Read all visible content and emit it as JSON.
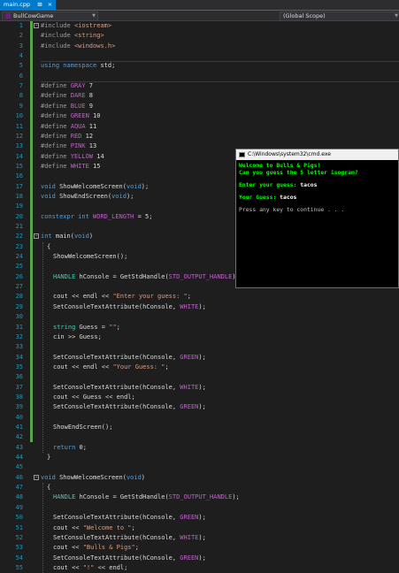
{
  "tab": {
    "label": "main.cpp",
    "pin": "⊞",
    "close": "×"
  },
  "nav": {
    "project": "BullCowGame",
    "scope": "(Global Scope)"
  },
  "console": {
    "title": "C:\\Windows\\system32\\cmd.exe",
    "lines": [
      "Welcome to Bulls & Pigs!",
      "Can you guess the 5 letter isogram?",
      "Enter your guess: ",
      "tacos",
      "Your Guess: ",
      "tacos",
      "Press any key to continue . . ."
    ]
  },
  "code": [
    {
      "n": "1",
      "t": "#include <iostream>"
    },
    {
      "n": "2",
      "t": "#include <string>"
    },
    {
      "n": "3",
      "t": "#include <windows.h>"
    },
    {
      "n": "4",
      "t": ""
    },
    {
      "n": "5",
      "t": "using namespace std;"
    },
    {
      "n": "6",
      "t": ""
    },
    {
      "n": "7",
      "t": "#define GRAY 7"
    },
    {
      "n": "8",
      "t": "#define DARE 8"
    },
    {
      "n": "9",
      "t": "#define BLUE 9"
    },
    {
      "n": "10",
      "t": "#define GREEN 10"
    },
    {
      "n": "11",
      "t": "#define AQUA 11"
    },
    {
      "n": "12",
      "t": "#define RED 12"
    },
    {
      "n": "13",
      "t": "#define PINK 13"
    },
    {
      "n": "14",
      "t": "#define YELLOW 14"
    },
    {
      "n": "15",
      "t": "#define WHITE 15"
    },
    {
      "n": "16",
      "t": ""
    },
    {
      "n": "17",
      "t": "void ShowWelcomeScreen(void);"
    },
    {
      "n": "18",
      "t": "void ShowEndScreen(void);"
    },
    {
      "n": "19",
      "t": ""
    },
    {
      "n": "20",
      "t": "constexpr int WORD_LENGTH = 5;"
    },
    {
      "n": "21",
      "t": ""
    },
    {
      "n": "22",
      "t": "int main(void)"
    },
    {
      "n": "23",
      "t": "{"
    },
    {
      "n": "24",
      "t": "ShowWelcomeScreen();"
    },
    {
      "n": "25",
      "t": ""
    },
    {
      "n": "26",
      "t": "HANDLE hConsole = GetStdHandle(STD_OUTPUT_HANDLE);"
    },
    {
      "n": "27",
      "t": ""
    },
    {
      "n": "28",
      "t": "cout << endl << \"Enter your guess: \";"
    },
    {
      "n": "29",
      "t": "SetConsoleTextAttribute(hConsole, WHITE);"
    },
    {
      "n": "30",
      "t": ""
    },
    {
      "n": "31",
      "t": "string Guess = \"\";"
    },
    {
      "n": "32",
      "t": "cin >> Guess;"
    },
    {
      "n": "33",
      "t": ""
    },
    {
      "n": "34",
      "t": "SetConsoleTextAttribute(hConsole, GREEN);"
    },
    {
      "n": "35",
      "t": "cout << endl << \"Your Guess: \";"
    },
    {
      "n": "36",
      "t": ""
    },
    {
      "n": "37",
      "t": "SetConsoleTextAttribute(hConsole, WHITE);"
    },
    {
      "n": "38",
      "t": "cout << Guess << endl;"
    },
    {
      "n": "39",
      "t": "SetConsoleTextAttribute(hConsole, GREEN);"
    },
    {
      "n": "40",
      "t": ""
    },
    {
      "n": "41",
      "t": "ShowEndScreen();"
    },
    {
      "n": "42",
      "t": ""
    },
    {
      "n": "43",
      "t": "return 0;"
    },
    {
      "n": "44",
      "t": "}"
    },
    {
      "n": "45",
      "t": ""
    },
    {
      "n": "46",
      "t": "void ShowWelcomeScreen(void)"
    },
    {
      "n": "47",
      "t": "{"
    },
    {
      "n": "48",
      "t": "HANDLE hConsole = GetStdHandle(STD_OUTPUT_HANDLE);"
    },
    {
      "n": "49",
      "t": ""
    },
    {
      "n": "50",
      "t": "SetConsoleTextAttribute(hConsole, GREEN);"
    },
    {
      "n": "51",
      "t": "cout << \"Welcome to \";"
    },
    {
      "n": "52",
      "t": "SetConsoleTextAttribute(hConsole, WHITE);"
    },
    {
      "n": "53",
      "t": "cout << \"Bulls & Pigs\";"
    },
    {
      "n": "54",
      "t": "SetConsoleTextAttribute(hConsole, GREEN);"
    },
    {
      "n": "55",
      "t": "cout << \"!\" << endl;"
    }
  ]
}
